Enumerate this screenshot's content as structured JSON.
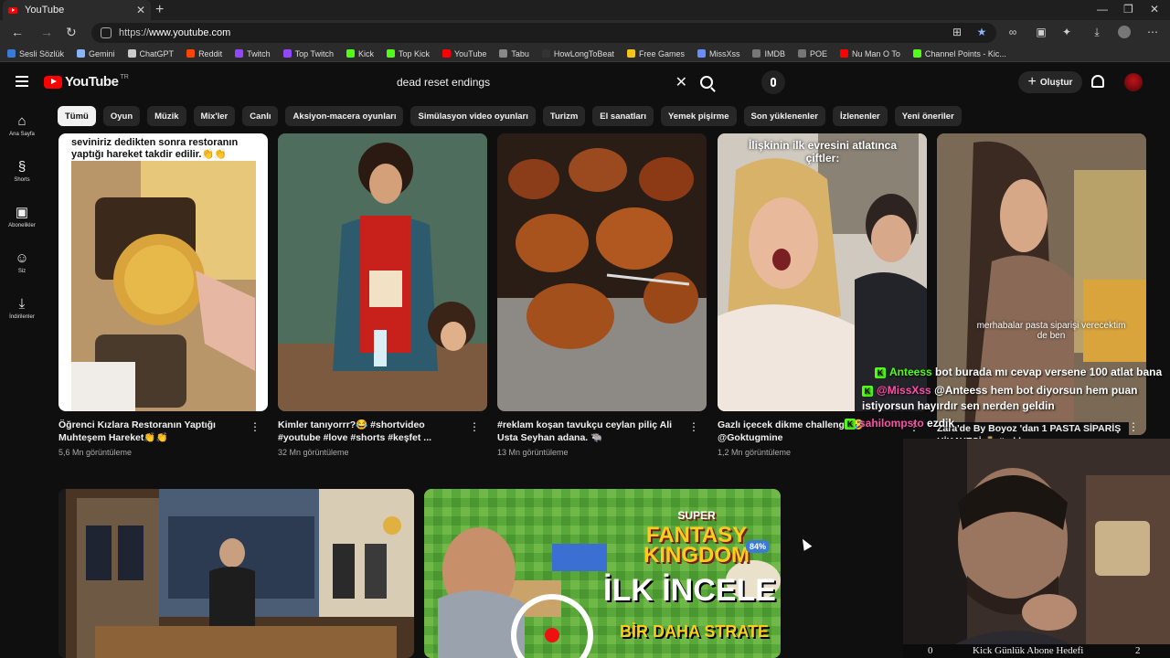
{
  "browser": {
    "tab_title": "YouTube",
    "url_prefix": "https://",
    "url_host": "www.youtube.com",
    "bookmarks": [
      {
        "label": "Sesli Sözlük",
        "color": "#3a7bd5"
      },
      {
        "label": "Gemini",
        "color": "#8ab4f8"
      },
      {
        "label": "ChatGPT",
        "color": "#cccccc"
      },
      {
        "label": "Reddit",
        "color": "#ff4500"
      },
      {
        "label": "Twitch",
        "color": "#9146ff"
      },
      {
        "label": "Top Twitch",
        "color": "#9146ff"
      },
      {
        "label": "Kick",
        "color": "#53fc18"
      },
      {
        "label": "Top Kick",
        "color": "#53fc18"
      },
      {
        "label": "YouTube",
        "color": "#ff0000"
      },
      {
        "label": "Tabu",
        "color": "#888888"
      },
      {
        "label": "HowLongToBeat",
        "color": "#333333"
      },
      {
        "label": "Free Games",
        "color": "#f5c518"
      },
      {
        "label": "MissXss",
        "color": "#6b8cff"
      },
      {
        "label": "IMDB",
        "color": "#777777"
      },
      {
        "label": "POE",
        "color": "#777777"
      },
      {
        "label": "Nu Man O To",
        "color": "#ff0000"
      },
      {
        "label": "Channel Points - Kic...",
        "color": "#53fc18"
      }
    ]
  },
  "youtube": {
    "logo_text": "YouTube",
    "country_code": "TR",
    "search_query": "dead reset endings",
    "create_label": "Oluştur",
    "sidebar": [
      {
        "icon": "home-icon",
        "glyph": "⌂",
        "label": "Ana Sayfa"
      },
      {
        "icon": "shorts-icon",
        "glyph": "§",
        "label": "Shorts"
      },
      {
        "icon": "subscriptions-icon",
        "glyph": "▣",
        "label": "Abonelikler"
      },
      {
        "icon": "you-icon",
        "glyph": "☺",
        "label": "Siz"
      },
      {
        "icon": "downloads-icon",
        "glyph": "⤓",
        "label": "İndirilenler"
      }
    ],
    "chips": [
      "Tümü",
      "Oyun",
      "Müzik",
      "Mix'ler",
      "Canlı",
      "Aksiyon-macera oyunları",
      "Simülasyon video oyunları",
      "Turizm",
      "El sanatları",
      "Yemek pişirme",
      "Son yüklenenler",
      "İzlenenler",
      "Yeni öneriler"
    ],
    "shorts": [
      {
        "title": "Öğrenci Kızlara Restoranın Yaptığı Muhteşem Hareket👏👏",
        "views": "5,6 Mn görüntüleme",
        "caption": "seviniriz dedikten sonra restoranın yaptığı hareket takdir edilir.👏👏"
      },
      {
        "title": "Kimler tanıyorrr?😂 #shortvideo #youtube #love #shorts #keşfet ...",
        "views": "32 Mn görüntüleme",
        "caption": ""
      },
      {
        "title": "#reklam koşan tavukçu ceylan piliç Ali Usta Seyhan adana. 🐃",
        "views": "13 Mn görüntüleme",
        "caption": ""
      },
      {
        "title": "Gazlı içecek dikme challenge 🤣 @Goktugmine",
        "views": "1,2 Mn görüntüleme",
        "caption": "İlişkinin ilk evresini atlatınca çiftler:"
      },
      {
        "title": "Zara'de By Boyoz 'dan 1 PASTA SİPARİŞ HİKAYESİ 🎂 #reklam",
        "views": "",
        "caption": "merhabalar pasta siparişi verecektim de ben"
      }
    ]
  },
  "overlay": {
    "chat": [
      {
        "user": "Anteess",
        "user_color": "#53fc18",
        "text": "bot burada mı cevap versene 100 atlat bana"
      },
      {
        "user": "@MissXss",
        "user_color": "#ff4fa8",
        "text": "@Anteess hem bot diyorsun hem puan istiyorsun hayırdır sen nerden geldin"
      },
      {
        "user": "sahilompsto",
        "user_color": "#ff4fa8",
        "text": "ezdik"
      }
    ],
    "game_thumb": {
      "title_line1": "SUPER",
      "title_line2": "FANTASY",
      "title_line3": "KINGDOM",
      "percent": "84%",
      "headline": "İLK İNCELE",
      "subline": "BİR DAHA STRATE"
    },
    "goal_bar": {
      "left": "0",
      "label": "Kick Günlük Abone Hedefi",
      "right": "2"
    }
  }
}
